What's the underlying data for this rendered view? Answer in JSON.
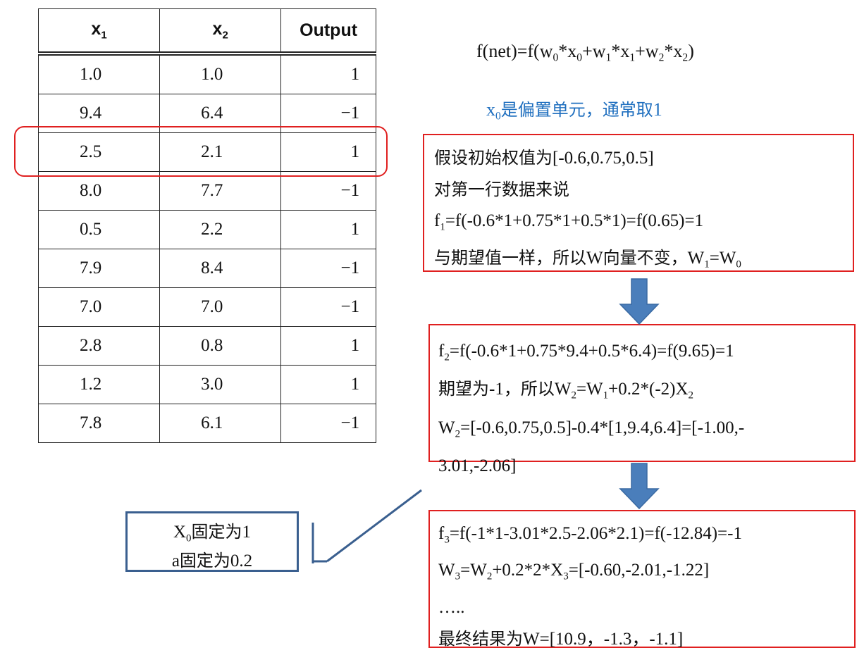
{
  "table": {
    "headers": [
      {
        "base": "x",
        "sub": "1"
      },
      {
        "base": "x",
        "sub": "2"
      },
      {
        "base": "Output",
        "sub": ""
      }
    ],
    "rows": [
      [
        "1.0",
        "1.0",
        "1"
      ],
      [
        "9.4",
        "6.4",
        "−1"
      ],
      [
        "2.5",
        "2.1",
        "1"
      ],
      [
        "8.0",
        "7.7",
        "−1"
      ],
      [
        "0.5",
        "2.2",
        "1"
      ],
      [
        "7.9",
        "8.4",
        "−1"
      ],
      [
        "7.0",
        "7.0",
        "−1"
      ],
      [
        "2.8",
        "0.8",
        "1"
      ],
      [
        "1.2",
        "3.0",
        "1"
      ],
      [
        "7.8",
        "6.1",
        "−1"
      ]
    ]
  },
  "formula": {
    "p1": "f(net)=f(w",
    "s1": "0",
    "p2": "*x",
    "s2": "0",
    "p3": "+w",
    "s3": "1",
    "p4": "*x",
    "s4": "1",
    "p5": "+w",
    "s5": "2",
    "p6": "*x",
    "s6": "2",
    "p7": ")"
  },
  "note": {
    "p1": "x",
    "s1": "0",
    "p2": "是偏置单元，通常取",
    "p3": "1"
  },
  "box1": {
    "line1_cjk": "假设初始权值为",
    "line1_rest": "[-0.6,0.75,0.5]",
    "line2_cjk": "对第一行数据来说",
    "line3_a": "f",
    "line3_s": "1",
    "line3_b": "=f(-0.6*1+0.75*1+0.5*1)=f(0.65)=1",
    "line4_cjk": "与期望值一样，所以",
    "line4_w": "W",
    "line4_cjk2": "向量不变，",
    "line4_a": "W",
    "line4_s1": "1",
    "line4_eq": "=W",
    "line4_s0": "0"
  },
  "box2": {
    "line1_a": "f",
    "line1_s": "2",
    "line1_b": "=f(-0.6*1+0.75*9.4+0.5*6.4)=f(9.65)=1",
    "line2_cjk": "期望为",
    "line2_m1": "-1",
    "line2_cjk2": "，所以",
    "line2_a": "W",
    "line2_s2": "2",
    "line2_b": "=W",
    "line2_s1": "1",
    "line2_c": "+0.2*(-2)X",
    "line2_s3": "2",
    "line3_a": "W",
    "line3_s": "2",
    "line3_b": "=[-0.6,0.75,0.5]-0.4*[1,9.4,6.4]=[-1.00,-",
    "line4": "3.01,-2.06]"
  },
  "box3": {
    "line1_a": "f",
    "line1_s": "3",
    "line1_b": "=f(-1*1-3.01*2.5-2.06*2.1)=f(-12.84)=-1",
    "line2_a": "W",
    "line2_s3": "3",
    "line2_b": "=W",
    "line2_s2": "2",
    "line2_c": "+0.2*2*X",
    "line2_s4": "3",
    "line2_d": "=[-0.60,-2.01,-1.22]",
    "line3": "…..",
    "line4_cjk": "最终结果为",
    "line4_rest": "W=[10.9，-1.3，-1.1]"
  },
  "side_note": {
    "line1_a": "X",
    "line1_s": "0",
    "line1_cjk": "固定为",
    "line1_v": "1",
    "line2_a": "a",
    "line2_cjk": "固定为",
    "line2_v": "0.2"
  },
  "colors": {
    "highlight_border": "#e02020",
    "note_text": "#1f6fbf",
    "arrow_fill": "#4a7ebb",
    "side_box_border": "#3a5f8f"
  },
  "icons": [
    "down-arrow-icon",
    "down-arrow-icon"
  ]
}
